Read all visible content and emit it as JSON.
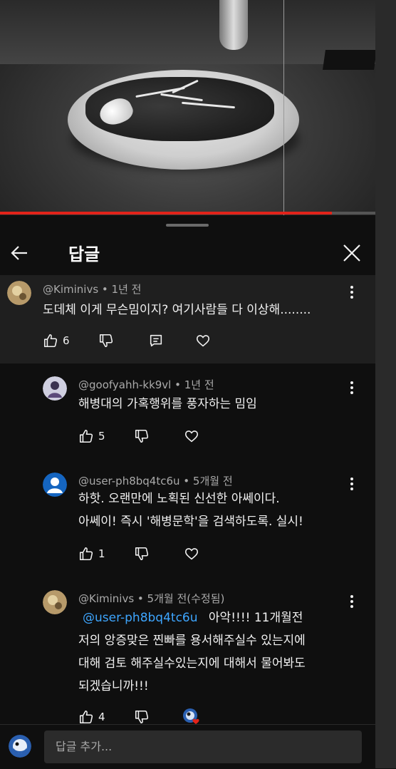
{
  "video": {
    "progress": 0.885
  },
  "header": {
    "title": "답글"
  },
  "parent_comment": {
    "author": "@Kiminivs",
    "time": "1년 전",
    "text": "도데체 이게 무슨밈이지? 여기사람들 다 이상해........",
    "likes": "6"
  },
  "replies": [
    {
      "author": "@goofyahh-kk9vl",
      "time": "1년 전",
      "lines": [
        "해병대의 가혹행위를 풍자하는 밈임"
      ],
      "likes": "5"
    },
    {
      "author": "@user-ph8bq4tc6u",
      "time": "5개월 전",
      "lines": [
        "하핫. 오랜만에 노획된 신선한 아쎄이다.",
        "아쎄이! 즉시 '해병문학'을 검색하도록. 실시!"
      ],
      "likes": "1"
    },
    {
      "author": "@Kiminivs",
      "time": "5개월 전(수정됨)",
      "mention": "@user-ph8bq4tc6u",
      "first_line_rest": "아악!!!! 11개월전",
      "lines": [
        "저의 앙증맞은 찐빠를 용서해주실수 있는지에",
        "대해 검토 해주실수있는지에 대해서 물어봐도",
        "되겠습니까!!!"
      ],
      "likes": "4"
    }
  ],
  "reply_input": {
    "placeholder": "답글 추가..."
  },
  "colors": {
    "accent_red": "#e2231a",
    "mention_blue": "#3ea6ff",
    "background": "#0f0f0f"
  }
}
